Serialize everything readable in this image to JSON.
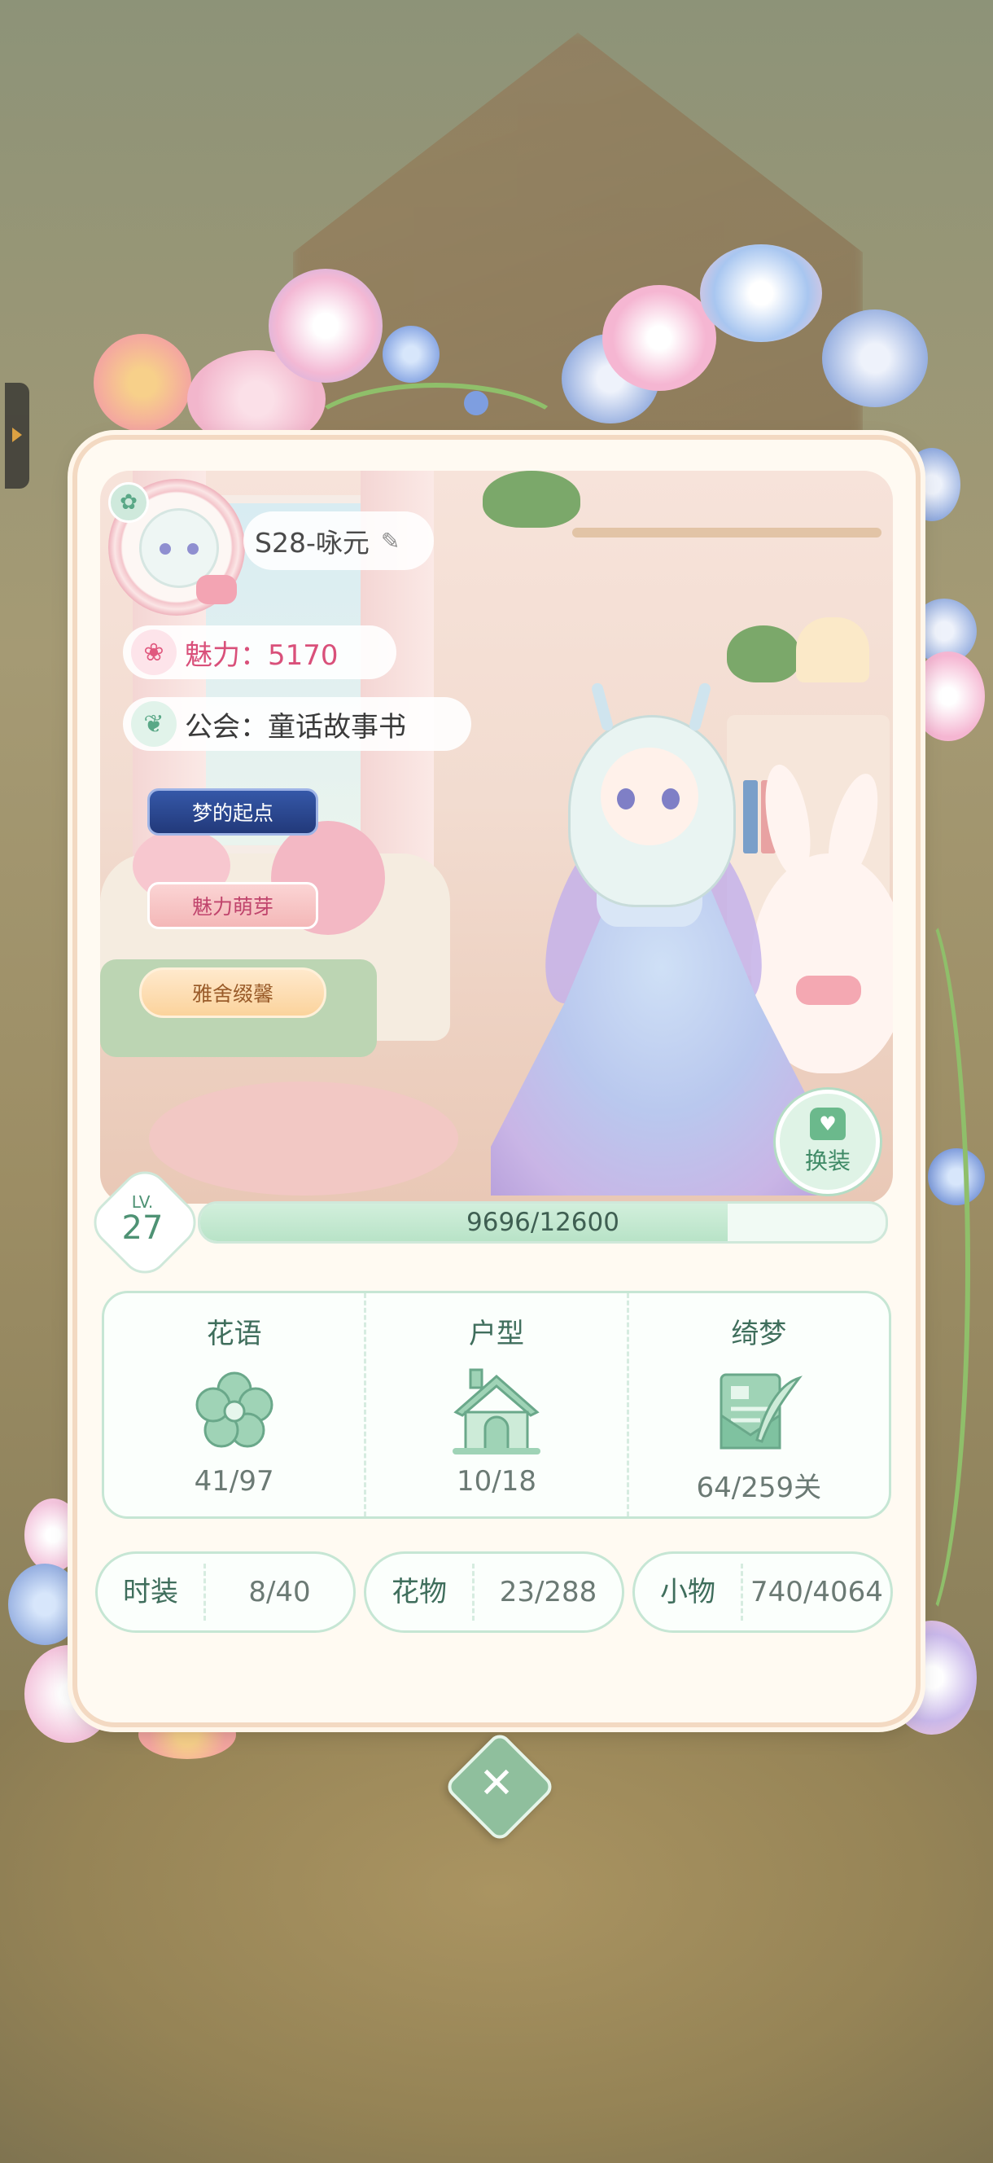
{
  "profile": {
    "name": "S28-咏元",
    "charm_label": "魅力：5170",
    "guild_label": "公会：童话故事书",
    "badges": [
      "梦的起点",
      "魅力萌芽",
      "雅舍缀馨"
    ],
    "outfit_button": "换装"
  },
  "level": {
    "label": "LV.",
    "value": "27",
    "xp_text": "9696/12600",
    "xp_current": 9696,
    "xp_max": 12600
  },
  "collections": [
    {
      "title": "花语",
      "value": "41/97",
      "icon": "flower-icon"
    },
    {
      "title": "户型",
      "value": "10/18",
      "icon": "house-icon"
    },
    {
      "title": "绮梦",
      "value": "64/259关",
      "icon": "quill-letter-icon"
    }
  ],
  "mini_stats": [
    {
      "label": "时装",
      "value": "8/40"
    },
    {
      "label": "花物",
      "value": "23/288"
    },
    {
      "label": "小物",
      "value": "740/4064"
    }
  ],
  "colors": {
    "accent_green": "#8fbf9d",
    "charm_pink": "#d9507a",
    "text_dark": "#4a4a4a"
  }
}
